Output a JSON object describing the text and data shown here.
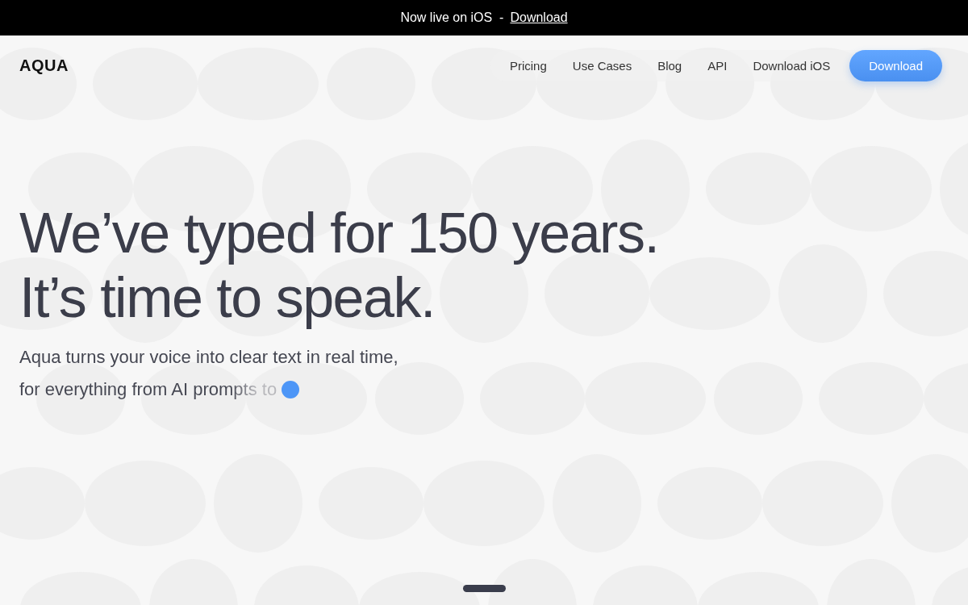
{
  "announcement": {
    "text": "Now live on iOS  -",
    "link": "Download"
  },
  "header": {
    "logo": "AQUA",
    "nav": [
      "Pricing",
      "Use Cases",
      "Blog",
      "API",
      "Download iOS"
    ],
    "cta": "Download"
  },
  "hero": {
    "headline": [
      "We’ve typed for 150 years.",
      "It’s time to speak."
    ],
    "subtitle": [
      "Aqua turns your voice into clear text in real time,",
      "for everything from AI prompts to"
    ]
  }
}
